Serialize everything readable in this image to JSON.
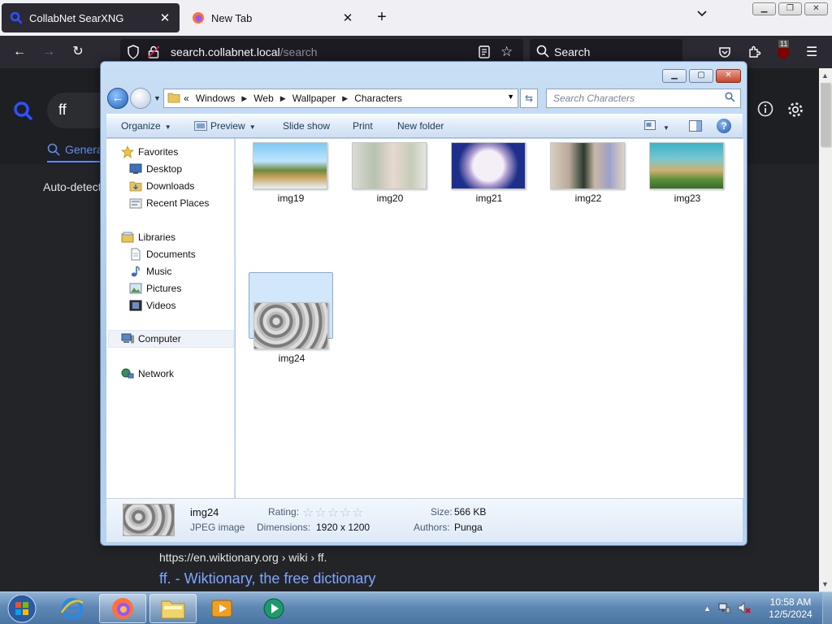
{
  "browser": {
    "tabs": [
      {
        "label": "CollabNet SearXNG",
        "active": true
      },
      {
        "label": "New Tab",
        "active": false
      }
    ],
    "url_host": "search.collabnet.local",
    "url_path": "/search",
    "search_placeholder": "Search",
    "extension_badge": "11"
  },
  "searx": {
    "query": "ff",
    "category_label": "General",
    "language_label": "Auto-detect",
    "result_url": "https://en.wiktionary.org  › wiki › ff.",
    "result_title": "ff. - Wiktionary, the free dictionary"
  },
  "explorer": {
    "breadcrumb": [
      "«",
      "Windows",
      "Web",
      "Wallpaper",
      "Characters"
    ],
    "search_placeholder": "Search Characters",
    "toolbar": {
      "organize": "Organize",
      "preview": "Preview",
      "slideshow": "Slide show",
      "print": "Print",
      "new_folder": "New folder"
    },
    "nav": {
      "favorites": "Favorites",
      "desktop": "Desktop",
      "downloads": "Downloads",
      "recent": "Recent Places",
      "libraries": "Libraries",
      "documents": "Documents",
      "music": "Music",
      "pictures": "Pictures",
      "videos": "Videos",
      "computer": "Computer",
      "network": "Network"
    },
    "files": [
      {
        "name": "img19",
        "selected": false
      },
      {
        "name": "img20",
        "selected": false
      },
      {
        "name": "img21",
        "selected": false
      },
      {
        "name": "img22",
        "selected": false
      },
      {
        "name": "img23",
        "selected": false
      },
      {
        "name": "img24",
        "selected": true
      }
    ],
    "details": {
      "name": "img24",
      "type": "JPEG image",
      "rating_label": "Rating:",
      "rating": 0,
      "rating_max": 5,
      "dimensions_label": "Dimensions:",
      "dimensions": "1920 x 1200",
      "size_label": "Size:",
      "size": "566 KB",
      "authors_label": "Authors:",
      "authors": "Punga"
    }
  },
  "taskbar": {
    "time": "10:58 AM",
    "date": "12/5/2024"
  },
  "colors": {
    "firefox_dark": "#2b2a33",
    "searx_accent": "#5e8cf4",
    "aero_blue": "#a9c8ea",
    "selection": "#d3e7fb"
  }
}
